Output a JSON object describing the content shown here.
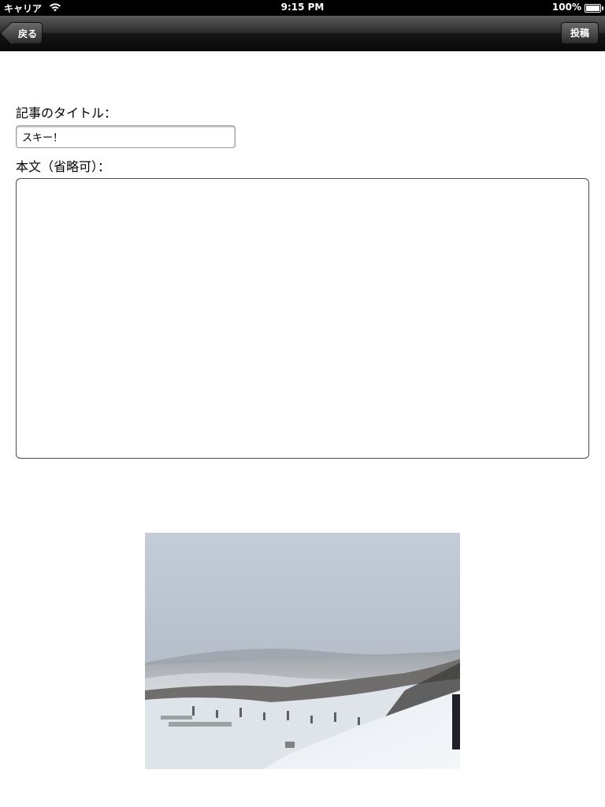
{
  "status_bar": {
    "carrier": "キャリア",
    "time": "9:15 PM",
    "battery": "100%"
  },
  "nav": {
    "back_label": "戻る",
    "post_label": "投稿"
  },
  "form": {
    "title_label": "記事のタイトル：",
    "title_value": "スキー！",
    "body_label": "本文（省略可）：",
    "body_value": ""
  },
  "photo": {
    "description_icon": "snow-landscape-photo"
  }
}
